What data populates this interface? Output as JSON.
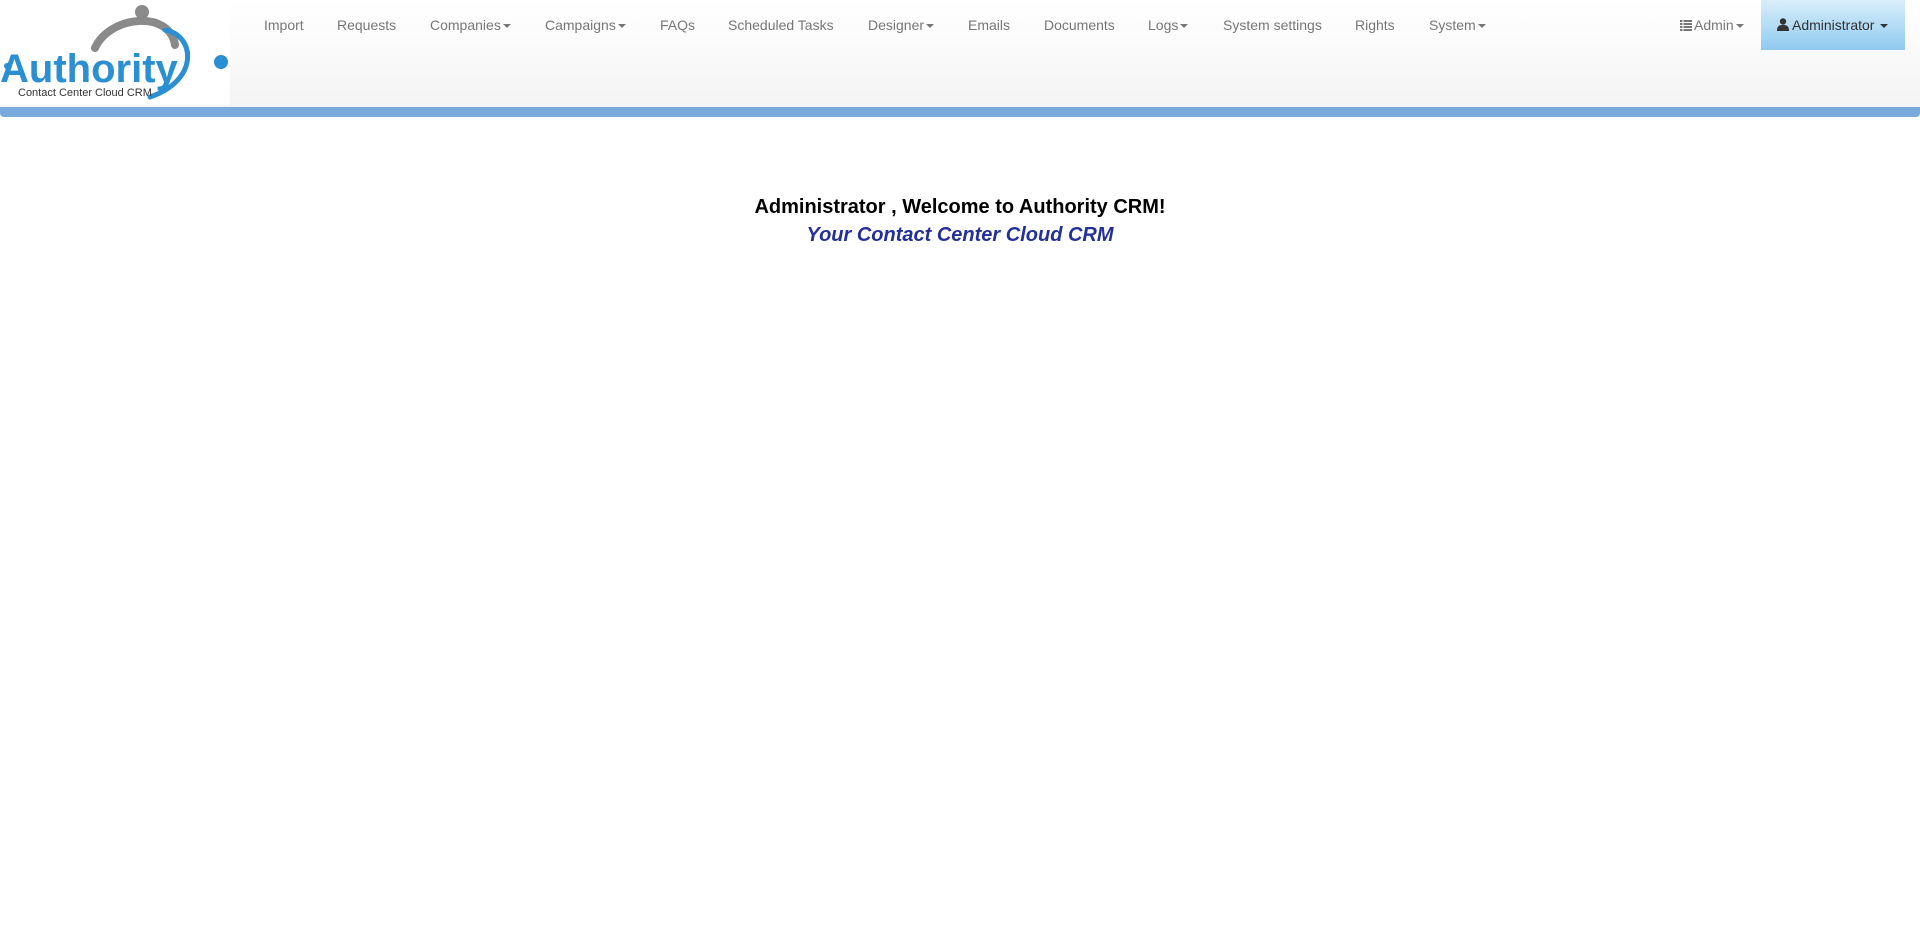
{
  "logo": {
    "brand_text": "Authority",
    "sub_text": "Contact Center Cloud CRM"
  },
  "nav": {
    "items": [
      {
        "label": "Import",
        "dropdown": false
      },
      {
        "label": "Requests",
        "dropdown": false
      },
      {
        "label": "Companies",
        "dropdown": true
      },
      {
        "label": "Campaigns",
        "dropdown": true
      },
      {
        "label": "FAQs",
        "dropdown": false
      },
      {
        "label": "Scheduled Tasks",
        "dropdown": false
      },
      {
        "label": "Designer",
        "dropdown": true
      },
      {
        "label": "Emails",
        "dropdown": false
      },
      {
        "label": "Documents",
        "dropdown": false
      },
      {
        "label": "Logs",
        "dropdown": true
      },
      {
        "label": "System settings",
        "dropdown": false
      },
      {
        "label": "Rights",
        "dropdown": false
      },
      {
        "label": "System",
        "dropdown": true
      }
    ],
    "admin_menu": {
      "label": "Admin",
      "icon": "list-icon"
    },
    "user_menu": {
      "label": "Administrator",
      "icon": "user-icon"
    }
  },
  "main": {
    "welcome": "Administrator , Welcome to Authority CRM!",
    "tagline": "Your Contact Center Cloud CRM"
  },
  "colors": {
    "nav_accent_bar": "#79a9dd",
    "tagline": "#23309a",
    "user_button": "#8fcaf0",
    "logo_blue": "#2a8fd3"
  }
}
